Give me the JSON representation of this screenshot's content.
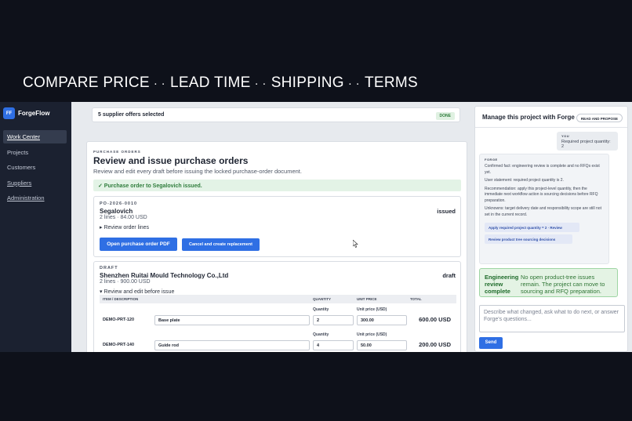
{
  "banner": {
    "parts": [
      "COMPARE PRICE",
      "LEAD TIME",
      "SHIPPING",
      "TERMS"
    ],
    "separator": "· ·"
  },
  "brand": {
    "logo": "FF",
    "name": "ForgeFlow"
  },
  "sidebar": {
    "items": [
      {
        "label": "Work Center"
      },
      {
        "label": "Projects"
      },
      {
        "label": "Customers"
      },
      {
        "label": "Suppliers"
      },
      {
        "label": "Administration"
      }
    ]
  },
  "selection": {
    "text": "5 supplier offers selected",
    "badge": "DONE"
  },
  "purchase_orders": {
    "eyebrow": "PURCHASE ORDERS",
    "title": "Review and issue purchase orders",
    "subtitle": "Review and edit every draft before issuing the locked purchase-order document.",
    "success": "✓ Purchase order to Segalovich issued.",
    "issued": {
      "code": "PO-2026-0010",
      "vendor": "Segalovich",
      "meta": "2 lines · 84.00 USD",
      "status": "issued",
      "disclosure": "▸ Review order lines",
      "open_button": "Open purchase order PDF",
      "cancel_button": "Cancel and create replacement"
    },
    "draft": {
      "label": "DRAFT",
      "vendor": "Shenzhen Ruitai Mould Technology Co.,Ltd",
      "meta": "2 lines · 900.00 USD",
      "status": "draft",
      "disclosure": "▾ Review and edit before issue",
      "columns": [
        "ITEM / DESCRIPTION",
        "QUANTITY",
        "UNIT PRICE",
        "TOTAL"
      ],
      "qty_label": "Quantity",
      "price_label": "Unit price (USD)",
      "lines": [
        {
          "part": "DEMO-PRT-120",
          "description": "Base plate",
          "quantity": "2",
          "unit_price": "300.00",
          "total": "600.00 USD"
        },
        {
          "part": "DEMO-PRT-140",
          "description": "Guide rod",
          "quantity": "4",
          "unit_price": "50.00",
          "total": "200.00 USD"
        }
      ]
    }
  },
  "panel": {
    "title": "Manage this project with Forge",
    "badge": "READ AND PROPOSE",
    "you_label": "YOU",
    "you_text": "Required project quantity: 2",
    "forge_label": "FORGE",
    "forge_messages": [
      "Confirmed fact: engineering review is complete and no RFQs exist yet.",
      "User statement: required project quantity is 2.",
      "Recommendation: apply this project-level quantity, then the immediate next workflow action is sourcing decisions before RFQ preparation.",
      "Unknowns: target delivery date and responsibility scope are still not set in the current record."
    ],
    "actions": [
      "Apply required project quantity = 2 · Review",
      "Review product tree sourcing decisions"
    ],
    "status_head": "Engineering review complete",
    "status_body": "No open product-tree issues remain. The project can move to sourcing and RFQ preparation.",
    "input_placeholder": "Describe what changed, ask what to do next, or answer Forge's questions...",
    "send": "Send"
  }
}
